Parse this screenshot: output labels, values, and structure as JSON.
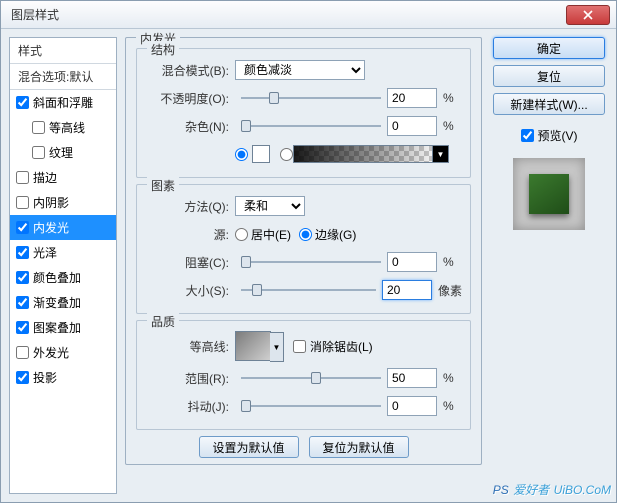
{
  "dialog": {
    "title": "图层样式",
    "close_icon": "×"
  },
  "styleList": {
    "header": "样式",
    "blendDefault": "混合选项:默认",
    "items": [
      {
        "label": "斜面和浮雕",
        "checked": true,
        "indent": false
      },
      {
        "label": "等高线",
        "checked": false,
        "indent": true
      },
      {
        "label": "纹理",
        "checked": false,
        "indent": true
      },
      {
        "label": "描边",
        "checked": false,
        "indent": false
      },
      {
        "label": "内阴影",
        "checked": false,
        "indent": false
      },
      {
        "label": "内发光",
        "checked": true,
        "indent": false,
        "selected": true
      },
      {
        "label": "光泽",
        "checked": true,
        "indent": false
      },
      {
        "label": "颜色叠加",
        "checked": true,
        "indent": false
      },
      {
        "label": "渐变叠加",
        "checked": true,
        "indent": false
      },
      {
        "label": "图案叠加",
        "checked": true,
        "indent": false
      },
      {
        "label": "外发光",
        "checked": false,
        "indent": false
      },
      {
        "label": "投影",
        "checked": true,
        "indent": false
      }
    ]
  },
  "panel": {
    "title": "内发光",
    "structure": {
      "title": "结构",
      "blendMode": {
        "label": "混合模式(B):",
        "value": "颜色减淡"
      },
      "opacity": {
        "label": "不透明度(O):",
        "value": "20",
        "unit": "%"
      },
      "noise": {
        "label": "杂色(N):",
        "value": "0",
        "unit": "%"
      },
      "colorRadio": true,
      "gradientRadio": false
    },
    "elements": {
      "title": "图素",
      "technique": {
        "label": "方法(Q):",
        "value": "柔和"
      },
      "sourceLabel": "源:",
      "sourceCenter": {
        "label": "居中(E)",
        "checked": false
      },
      "sourceEdge": {
        "label": "边缘(G)",
        "checked": true
      },
      "choke": {
        "label": "阻塞(C):",
        "value": "0",
        "unit": "%"
      },
      "size": {
        "label": "大小(S):",
        "value": "20",
        "unit": "像素"
      }
    },
    "quality": {
      "title": "品质",
      "contourLabel": "等高线:",
      "antialias": {
        "label": "消除锯齿(L)",
        "checked": false
      },
      "range": {
        "label": "范围(R):",
        "value": "50",
        "unit": "%"
      },
      "jitter": {
        "label": "抖动(J):",
        "value": "0",
        "unit": "%"
      }
    },
    "buttons": {
      "setDefault": "设置为默认值",
      "resetDefault": "复位为默认值"
    }
  },
  "right": {
    "ok": "确定",
    "cancel": "复位",
    "newStyle": "新建样式(W)...",
    "preview": "预览(V)",
    "previewChecked": true
  },
  "watermark": "UiBO.CoM"
}
